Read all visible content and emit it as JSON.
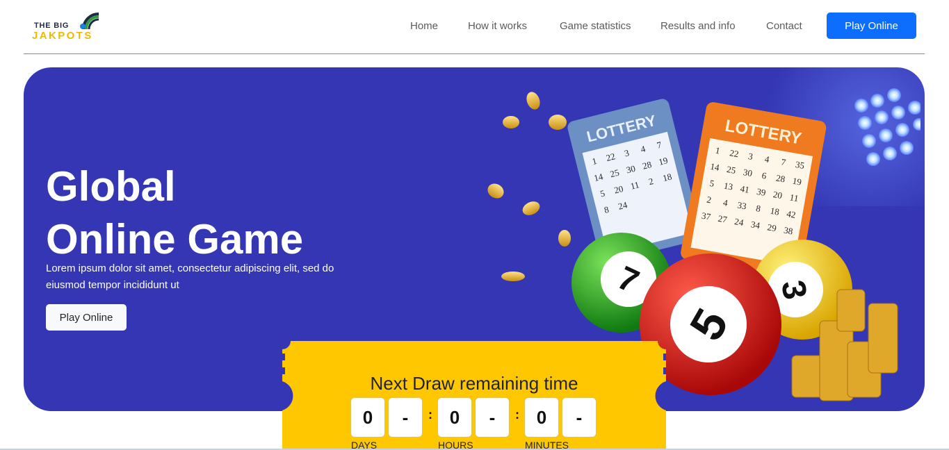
{
  "logo": {
    "top": "THE BIG",
    "bottom": "JAKPOTS"
  },
  "nav": {
    "items": [
      "Home",
      "How it works",
      "Game statistics",
      "Results and info",
      "Contact"
    ],
    "cta": "Play Online"
  },
  "hero": {
    "title_line1": "Global",
    "title_line2": "Online Game",
    "subtitle": "Lorem ipsum dolor sit amet, consectetur adipiscing elit, sed do eiusmod tempor incididunt ut",
    "button": "Play Online",
    "ticket_left": {
      "label": "LOTTERY",
      "numbers": [
        1,
        22,
        3,
        4,
        7,
        14,
        25,
        30,
        28,
        19,
        5,
        20,
        11,
        2,
        18,
        8,
        24
      ]
    },
    "ticket_right": {
      "label": "LOTTERY",
      "numbers": [
        1,
        22,
        3,
        4,
        7,
        35,
        14,
        25,
        30,
        6,
        28,
        19,
        5,
        13,
        41,
        39,
        20,
        11,
        2,
        4,
        33,
        8,
        18,
        42,
        37,
        27,
        24,
        34,
        29,
        38
      ]
    },
    "balls": [
      "7",
      "5",
      "3"
    ]
  },
  "countdown": {
    "title": "Next Draw remaining time",
    "days": [
      "0",
      "-"
    ],
    "hours": [
      "0",
      "-"
    ],
    "minutes": [
      "0",
      "-"
    ],
    "colon": ":",
    "labels": {
      "days": "DAYS",
      "hours": "HOURS",
      "minutes": "MINUTES"
    }
  },
  "colors": {
    "hero_bg": "#3436b3",
    "primary": "#0d6efd",
    "ticket_yellow": "#ffc700",
    "logo_yellow": "#f2b800"
  }
}
